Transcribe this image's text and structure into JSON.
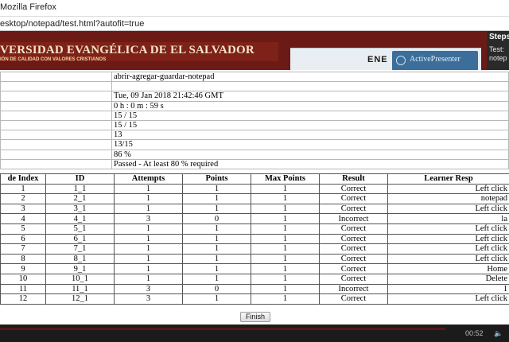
{
  "window": {
    "title": "Mozilla Firefox"
  },
  "address_bar": {
    "url": "esktop/notepad/test.html?autofit=true"
  },
  "banner": {
    "university": "VERSIDAD EVANGÉLICA DE EL SALVADOR",
    "slogan": "IÓN DE CALIDAD CON VALORES CRISTIANOS",
    "panel_text": "ENE",
    "brand": "ActivePresenter"
  },
  "steps_panel": {
    "header": "Steps",
    "line1": "Test:",
    "line2": "notep"
  },
  "summary": {
    "rows": [
      "abrir-agregar-guardar-notepad",
      "",
      "Tue, 09 Jan 2018 21:42:46 GMT",
      "0 h : 0 m : 59 s",
      "15 / 15",
      "15 / 15",
      "13",
      "13/15",
      "86 %",
      "Passed - At least 80 % required"
    ]
  },
  "results": {
    "headers": [
      "de Index",
      "ID",
      "Attempts",
      "Points",
      "Max Points",
      "Result",
      "Learner Resp"
    ],
    "rows": [
      [
        "1",
        "1_1",
        "1",
        "1",
        "1",
        "Correct",
        "Left click"
      ],
      [
        "2",
        "2_1",
        "1",
        "1",
        "1",
        "Correct",
        "notepad"
      ],
      [
        "3",
        "3_1",
        "1",
        "1",
        "1",
        "Correct",
        "Left click"
      ],
      [
        "4",
        "4_1",
        "3",
        "0",
        "1",
        "Incorrect",
        "la"
      ],
      [
        "5",
        "5_1",
        "1",
        "1",
        "1",
        "Correct",
        "Left click"
      ],
      [
        "6",
        "6_1",
        "1",
        "1",
        "1",
        "Correct",
        "Left click"
      ],
      [
        "7",
        "7_1",
        "1",
        "1",
        "1",
        "Correct",
        "Left click"
      ],
      [
        "8",
        "8_1",
        "1",
        "1",
        "1",
        "Correct",
        "Left click"
      ],
      [
        "9",
        "9_1",
        "1",
        "1",
        "1",
        "Correct",
        "Home"
      ],
      [
        "10",
        "10_1",
        "1",
        "1",
        "1",
        "Correct",
        "Delete"
      ],
      [
        "11",
        "11_1",
        "3",
        "0",
        "1",
        "Incorrect",
        "1"
      ],
      [
        "12",
        "12_1",
        "3",
        "1",
        "1",
        "Correct",
        "Left click"
      ]
    ]
  },
  "buttons": {
    "finish": "Finish"
  },
  "player": {
    "time": "00:52",
    "volume_icon": "volume-icon"
  },
  "colors": {
    "banner": "#6c1a15",
    "player": "#1b1b1b"
  }
}
